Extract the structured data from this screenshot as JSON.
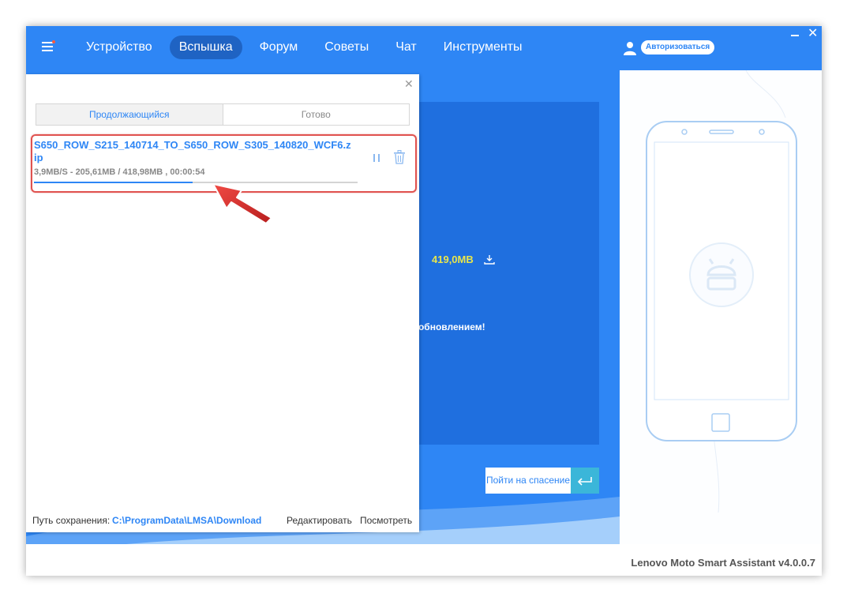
{
  "nav": {
    "items": [
      {
        "label": "Устройство"
      },
      {
        "label": "Вспышка"
      },
      {
        "label": "Форум"
      },
      {
        "label": "Советы"
      },
      {
        "label": "Чат"
      },
      {
        "label": "Инструменты"
      }
    ],
    "active_index": 1,
    "login_label": "Авторизоваться"
  },
  "main": {
    "size_text": "419,0MB",
    "notice_text": "д обновлением!",
    "rescue_button": "Пойти на спасение"
  },
  "panel": {
    "tabs": [
      {
        "label": "Продолжающийся",
        "active": true
      },
      {
        "label": "Готово",
        "active": false
      }
    ],
    "download": {
      "file_name": "S650_ROW_S215_140714_TO_S650_ROW_S305_140820_WCF6.zip",
      "stats": "3,9MB/S - 205,61MB / 418,98MB , 00:00:54",
      "progress": 0.49
    },
    "footer": {
      "path_label": "Путь сохранения:",
      "path_value": "C:\\ProgramData\\LMSA\\Download",
      "edit_label": "Редактировать",
      "view_label": "Посмотреть"
    }
  },
  "app": {
    "version": "Lenovo Moto Smart Assistant v4.0.0.7"
  },
  "colors": {
    "primary": "#2e86f5",
    "active_nav": "#1f63c3",
    "highlight": "#e0524f",
    "size_text": "#e9e64b"
  }
}
